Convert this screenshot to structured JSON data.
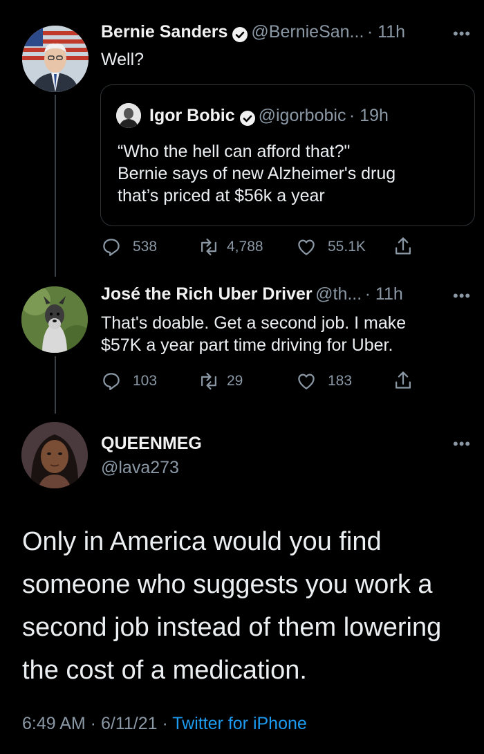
{
  "tweets": [
    {
      "name": "Bernie Sanders",
      "handle": "@BernieSan...",
      "time": "· 11h",
      "text": "Well?",
      "quote": {
        "name": "Igor Bobic",
        "handle": "@igorbobic",
        "time": "· 19h",
        "lines": [
          "“Who the hell can afford that?\"",
          "Bernie says of new Alzheimer's drug",
          "that’s priced at $56k a year"
        ]
      },
      "replies": "538",
      "retweets": "4,788",
      "likes": "55.1K"
    },
    {
      "name": "José the Rich Uber Driver",
      "handle": "@th...",
      "time": "· 11h",
      "lines": [
        "That's doable. Get a second job. I make",
        "$57K a year part time driving for Uber."
      ],
      "replies": "103",
      "retweets": "29",
      "likes": "183"
    }
  ],
  "main_tweet": {
    "name": "QUEENMEG",
    "handle": "@lava273",
    "lines": [
      "Only in America would you find",
      "someone who suggests you work a",
      "second job instead of them lowering",
      "the cost of a medication."
    ],
    "timestamp": "6:49 AM · 6/11/21 · ",
    "source": "Twitter for iPhone"
  },
  "colors": {
    "background": "#000000",
    "link": "#1d9bf0",
    "muted": "#8b98a5"
  },
  "icons": [
    "verified-icon",
    "more-icon",
    "reply-icon",
    "retweet-icon",
    "like-icon",
    "share-icon"
  ]
}
